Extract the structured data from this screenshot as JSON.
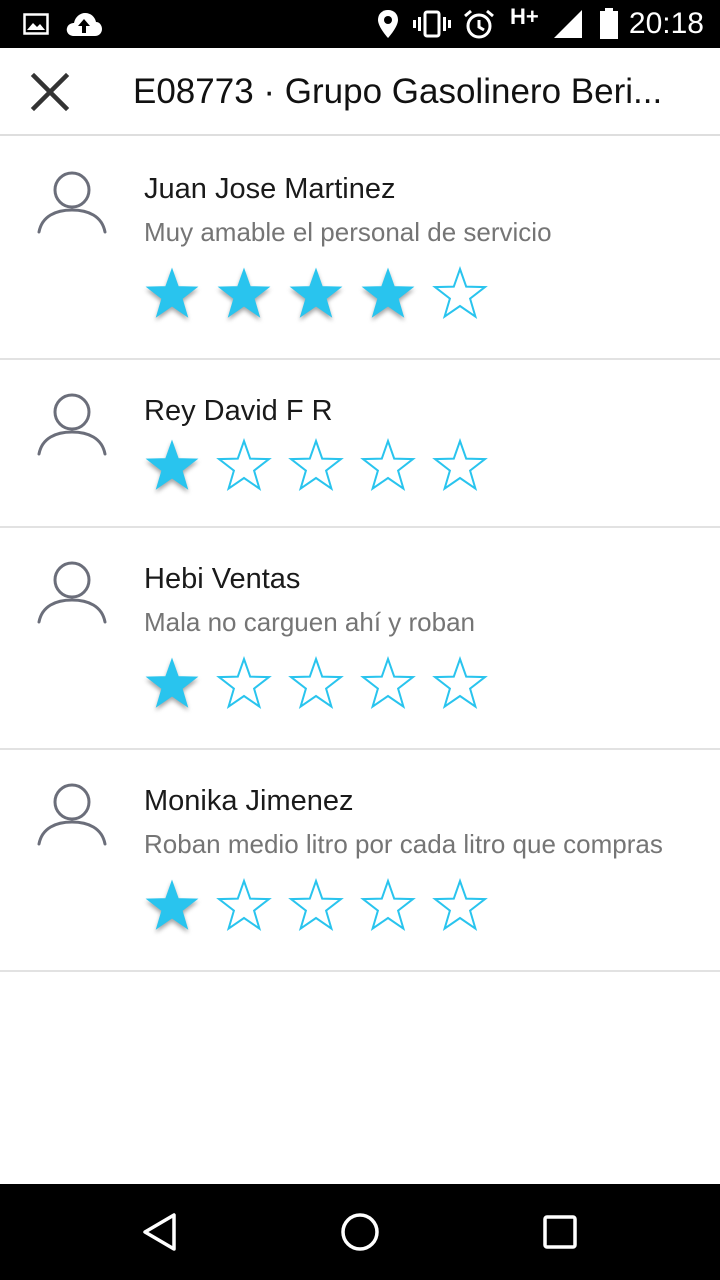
{
  "status_bar": {
    "time": "20:18",
    "network_label": "H+",
    "icons": [
      "image-icon",
      "cloud-upload-icon",
      "location-icon",
      "vibrate-icon",
      "alarm-icon",
      "signal-icon",
      "battery-icon"
    ]
  },
  "app_bar": {
    "close_icon": "close-icon",
    "title": "E08773 · Grupo Gasolinero Beri..."
  },
  "colors": {
    "star": "#29c4ee",
    "avatar": "#6b6e7a",
    "divider": "#e2e2e2"
  },
  "reviews": [
    {
      "name": "Juan Jose Martinez",
      "comment": "Muy amable el personal de servicio",
      "rating": 4,
      "max_rating": 5
    },
    {
      "name": "Rey David F R",
      "comment": "",
      "rating": 1,
      "max_rating": 5
    },
    {
      "name": "Hebi Ventas",
      "comment": "Mala no carguen ahí y roban",
      "rating": 1,
      "max_rating": 5
    },
    {
      "name": "Monika Jimenez",
      "comment": "Roban medio litro por cada litro que compras",
      "rating": 1,
      "max_rating": 5
    }
  ],
  "nav_bar": {
    "buttons": [
      "back-icon",
      "home-icon",
      "recents-icon"
    ]
  }
}
